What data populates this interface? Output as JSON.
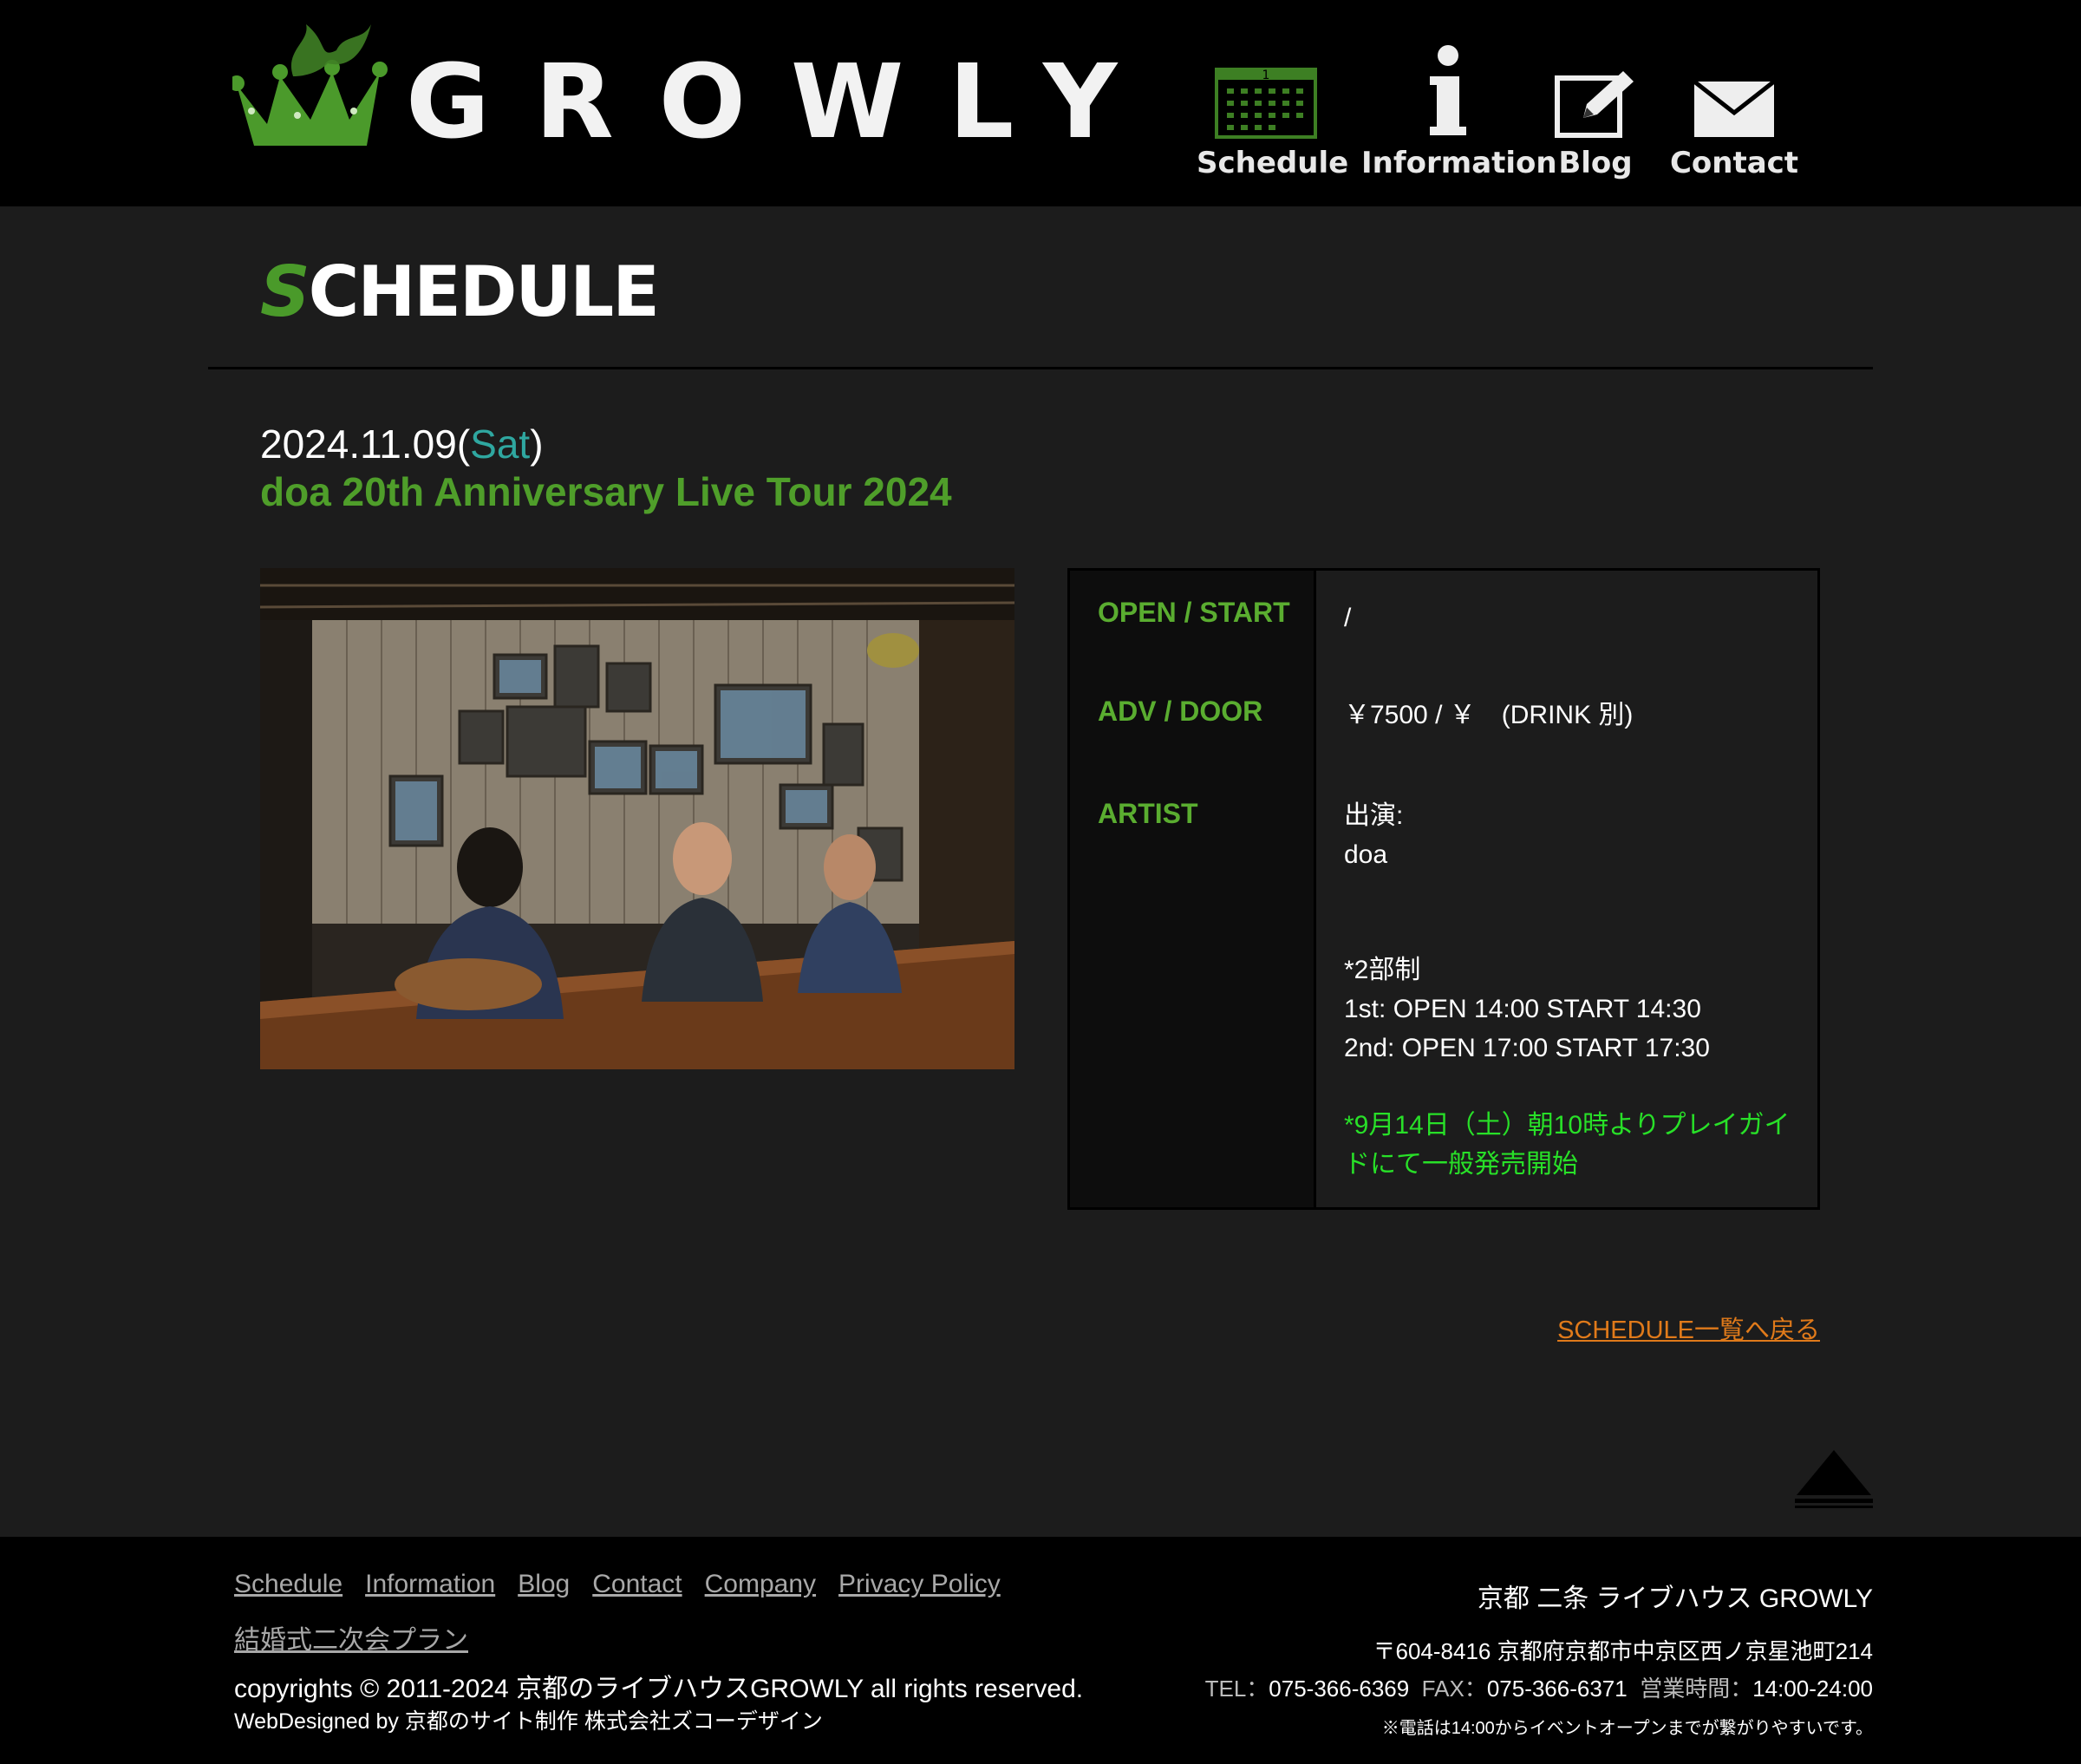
{
  "header": {
    "logo_text": "GROWLY",
    "nav": [
      {
        "label": "Schedule",
        "icon": "calendar-icon"
      },
      {
        "label": "Information",
        "icon": "info-icon"
      },
      {
        "label": "Blog",
        "icon": "pencil-icon"
      },
      {
        "label": "Contact",
        "icon": "mail-icon"
      }
    ]
  },
  "page": {
    "heading": "SCHEDULE",
    "heading_first": "S",
    "heading_rest": "CHEDULE"
  },
  "event": {
    "date": "2024.11.09",
    "date_open": "(",
    "day_of_week": "Sat",
    "date_close": ")",
    "title": "doa 20th Anniversary Live Tour 2024",
    "open_start_label": "OPEN / START",
    "open_start_value": "/",
    "adv_door_label": "ADV / DOOR",
    "adv_door_value": "￥7500 / ￥　(DRINK 別)",
    "artist_label": "ARTIST",
    "artist_lines": [
      "出演:",
      "doa"
    ],
    "schedule_lines": [
      "*2部制",
      "1st: OPEN 14:00 START 14:30",
      "2nd: OPEN 17:00 START 17:30"
    ],
    "notice": "*9月14日（土）朝10時よりプレイガイドにて一般発売開始",
    "notice_line1": "*9月14日（土）朝10時よりプレイガイ",
    "notice_line2": "ドにて一般発売開始"
  },
  "back_link": "SCHEDULE一覧へ戻る",
  "footer": {
    "nav": [
      "Schedule",
      "Information",
      "Blog",
      "Contact",
      "Company",
      "Privacy Policy"
    ],
    "nav2": "結婚式二次会プラン",
    "copyright": "copyrights © 2011-2024 京都のライブハウスGROWLY all rights reserved.",
    "webdesigned": "WebDesigned by 京都のサイト制作 株式会社ズコーデザイン",
    "venue_name": "京都 二条 ライブハウス GROWLY",
    "address": "〒604-8416 京都府京都市中京区西ノ京星池町214",
    "tel_label": "TEL：",
    "tel": "075-366-6369",
    "fax_label": "FAX：",
    "fax": "075-366-6371",
    "hours_label": "営業時間：",
    "hours": "14:00-24:00",
    "phone_note": "※電話は14:00からイベントオープンまでが繋がりやすいです。"
  },
  "colors": {
    "accent_green": "#4f9e2a",
    "notice_green": "#28e028",
    "link_orange": "#e07a1a",
    "dow_teal": "#2fa7a0"
  }
}
